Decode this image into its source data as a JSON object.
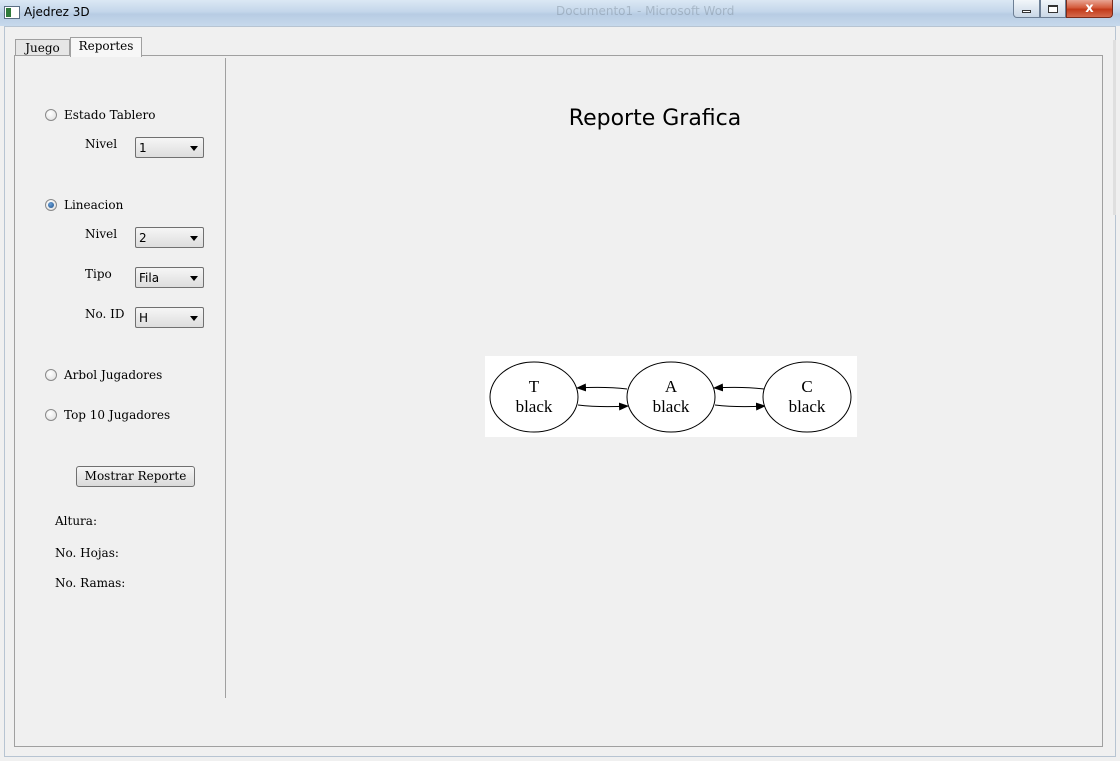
{
  "window": {
    "title": "Ajedrez 3D",
    "background_title": "Documento1 - Microsoft Word",
    "controls": {
      "minimize": "minimize",
      "maximize": "maximize",
      "close": "x"
    }
  },
  "tabs": [
    {
      "label": "Juego",
      "selected": false
    },
    {
      "label": "Reportes",
      "selected": true
    }
  ],
  "options": {
    "estado_tablero": {
      "label": "Estado Tablero",
      "checked": false,
      "nivel_label": "Nivel",
      "nivel_value": "1"
    },
    "lineacion": {
      "label": "Lineacion",
      "checked": true,
      "nivel_label": "Nivel",
      "nivel_value": "2",
      "tipo_label": "Tipo",
      "tipo_value": "Fila",
      "id_label": "No. ID",
      "id_value": "H"
    },
    "arbol_jugadores": {
      "label": "Arbol Jugadores",
      "checked": false
    },
    "top10": {
      "label": "Top 10 Jugadores",
      "checked": false
    }
  },
  "show_report_label": "Mostrar Reporte",
  "stats": {
    "altura_label": "Altura:",
    "hojas_label": "No. Hojas:",
    "ramas_label": "No. Ramas:"
  },
  "report": {
    "title": "Reporte Grafica",
    "nodes": [
      {
        "letter": "T",
        "color": "black"
      },
      {
        "letter": "A",
        "color": "black"
      },
      {
        "letter": "C",
        "color": "black"
      }
    ]
  }
}
